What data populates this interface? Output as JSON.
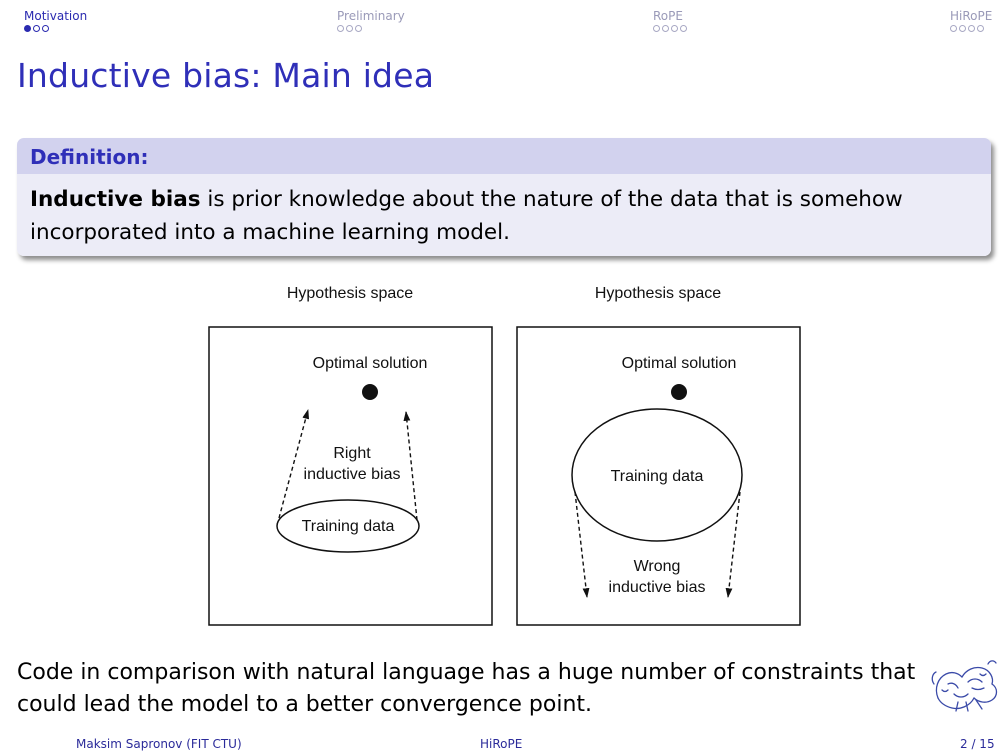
{
  "nav": {
    "sections": [
      {
        "label": "Motivation",
        "dots": 3,
        "filled": 1
      },
      {
        "label": "Preliminary",
        "dots": 3,
        "filled": 0
      },
      {
        "label": "RoPE",
        "dots": 4,
        "filled": 0
      },
      {
        "label": "HiRoPE",
        "dots": 4,
        "filled": 0
      }
    ]
  },
  "frame_title": "Inductive bias: Main idea",
  "definition": {
    "heading": "Definition:",
    "term": "Inductive bias",
    "text": " is prior knowledge about the nature of the data that is somehow incorporated into a machine learning model."
  },
  "figure": {
    "left": {
      "title": "Hypothesis space",
      "optimal": "Optimal solution",
      "bias_line1": "Right",
      "bias_line2": "inductive bias",
      "data": "Training data"
    },
    "right": {
      "title": "Hypothesis space",
      "optimal": "Optimal solution",
      "data": "Training data",
      "bias_line1": "Wrong",
      "bias_line2": "inductive bias"
    }
  },
  "paragraph": "Code in comparison with natural language has a huge number of constraints that could lead the model to a better convergence point.",
  "footer": {
    "author": "Maksim Sapronov  (FIT CTU)",
    "title": "HiRoPE",
    "page": "2 / 15"
  },
  "colors": {
    "accent": "#2f2fb8",
    "block_header": "#d2d2ee",
    "block_body": "#ececf7"
  }
}
